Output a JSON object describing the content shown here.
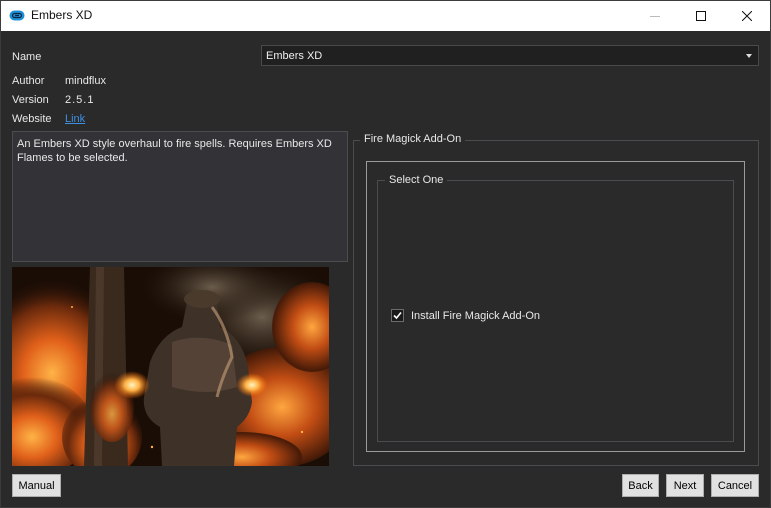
{
  "window": {
    "title": "Embers XD",
    "app_icon": "link-cloud-icon",
    "controls": [
      "minimize-icon",
      "maximize-icon",
      "close-icon"
    ]
  },
  "info": {
    "name_label": "Name",
    "name_value": "Embers XD",
    "author_label": "Author",
    "author_value": "mindflux",
    "version_label": "Version",
    "version_value": "2.5.1",
    "website_label": "Website",
    "website_link": "Link"
  },
  "description": "An Embers XD style overhaul to fire spells. Requires Embers XD Flames to be selected.",
  "preview_image": "fire-mage-casting-flames-image",
  "group": {
    "title": "Fire Magick Add-On",
    "subgroup_title": "Select One",
    "option_label": "Install Fire Magick Add-On",
    "option_checked": true
  },
  "buttons": {
    "manual": "Manual",
    "back": "Back",
    "next": "Next",
    "cancel": "Cancel"
  },
  "colors": {
    "background": "#2a2a2b",
    "titlebar": "#ffffff",
    "link": "#3d8fe0",
    "accent_icon": "#1e8fd6"
  }
}
